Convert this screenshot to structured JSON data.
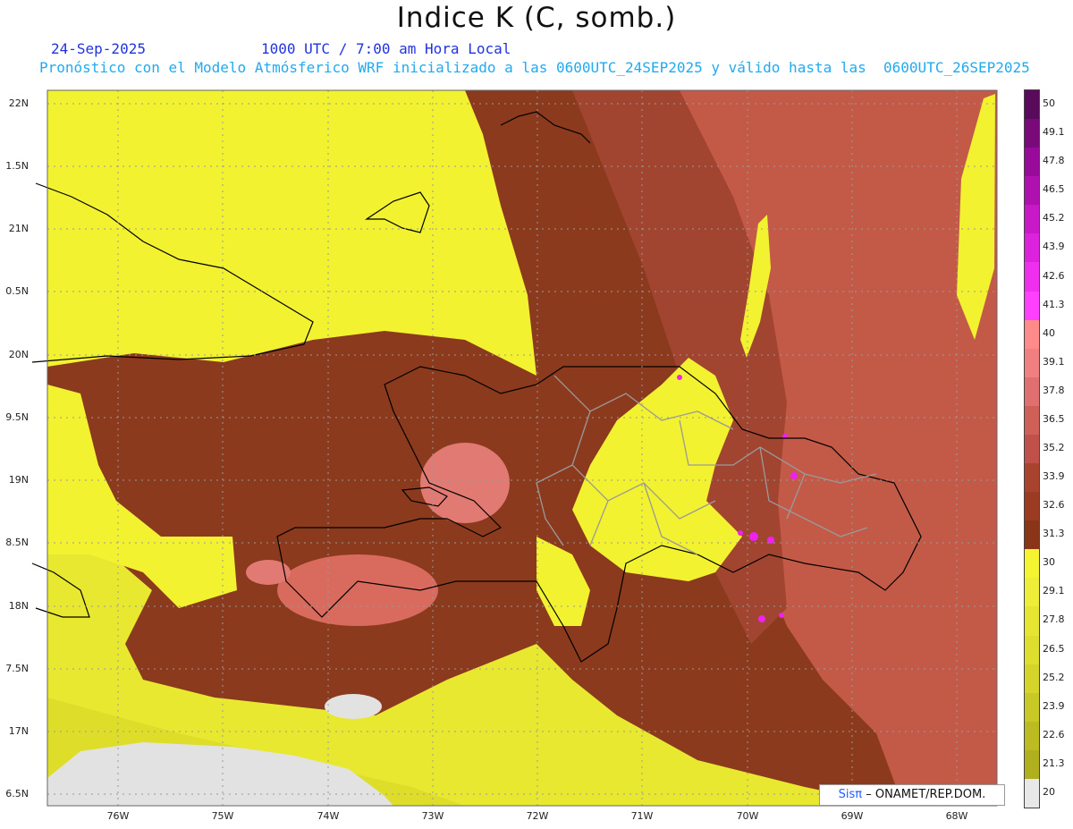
{
  "title": "Indice K (C, somb.)",
  "date": "24-Sep-2025",
  "valid_time": "1000 UTC / 7:00 am Hora Local",
  "forecast_line": "Pronóstico con el Modelo Atmósferico WRF inicializado a las 0600UTC_24SEP2025 y válido hasta las  0600UTC_26SEP2025",
  "colors": {
    "title_date": "#2233dd",
    "forecast_line": "#22aaee",
    "sea_high": "#c35a48",
    "mid": "#8b3a1e",
    "low": "#f2f230",
    "land_gray": "#e2e2e2",
    "pink": "#e0707a",
    "magenta": "#ee22ee"
  },
  "lat_ticks": [
    "22N",
    "1.5N",
    "21N",
    "0.5N",
    "20N",
    "9.5N",
    "19N",
    "8.5N",
    "18N",
    "7.5N",
    "17N",
    "6.5N"
  ],
  "lon_ticks": [
    "76W",
    "75W",
    "74W",
    "73W",
    "72W",
    "71W",
    "70W",
    "69W",
    "68W"
  ],
  "colorbar": {
    "labels": [
      "50",
      "49.1",
      "47.8",
      "46.5",
      "45.2",
      "43.9",
      "42.6",
      "41.3",
      "40",
      "39.1",
      "37.8",
      "36.5",
      "35.2",
      "33.9",
      "32.6",
      "31.3",
      "30",
      "29.1",
      "27.8",
      "26.5",
      "25.2",
      "23.9",
      "22.6",
      "21.3",
      "20"
    ],
    "colors": [
      "#5a0a5a",
      "#7a0a7a",
      "#9a0a9a",
      "#b010b0",
      "#c818c8",
      "#dd22dd",
      "#ee30ee",
      "#ff40ff",
      "#ff8a8a",
      "#f08080",
      "#e07070",
      "#cf6058",
      "#c0504a",
      "#a9432e",
      "#9a3b22",
      "#8a3418",
      "#f4f430",
      "#eeee38",
      "#e6e632",
      "#dede2e",
      "#d4d42a",
      "#c8c826",
      "#bcbc22",
      "#b0b01e",
      "#e8e8e8"
    ]
  },
  "credit": {
    "sis": "Sisπ",
    "rest": "– ONAMET/REP.DOM."
  }
}
